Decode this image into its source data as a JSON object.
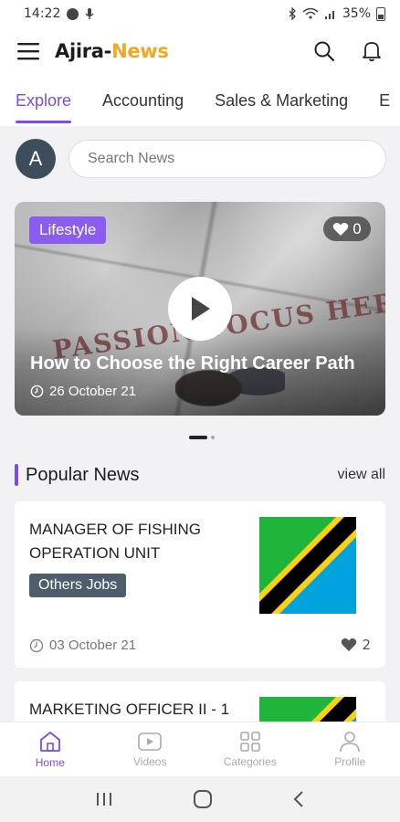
{
  "status_bar": {
    "time": "14:22",
    "battery": "35%"
  },
  "app": {
    "brand_part1": "Ajira-",
    "brand_part2": "News",
    "brand_color": "#f5a623",
    "accent_color": "#7a4de0"
  },
  "tabs": [
    {
      "label": "Explore",
      "active": true
    },
    {
      "label": "Accounting",
      "active": false
    },
    {
      "label": "Sales & Marketing",
      "active": false
    },
    {
      "label": "E",
      "active": false
    }
  ],
  "search": {
    "avatar_letter": "A",
    "placeholder": "Search News"
  },
  "featured": {
    "category": "Lifestyle",
    "likes": "0",
    "image_text": "PASSION FOCUS HERE",
    "title": "How to Choose the Right Career Path",
    "date": "26 October 21",
    "slide_index": 1,
    "slide_count": 2
  },
  "popular": {
    "heading": "Popular News",
    "view_all": "view all",
    "items": [
      {
        "title": "MANAGER OF FISHING OPERATION UNIT",
        "tag": "Others Jobs",
        "date": "03 October 21",
        "likes": "2",
        "thumb_icon": "tanzania-flag-icon"
      },
      {
        "title": "MARKETING OFFICER II - 1",
        "thumb_icon": "tanzania-flag-icon"
      }
    ]
  },
  "bottom_nav": [
    {
      "label": "Home",
      "icon": "home-icon",
      "active": true
    },
    {
      "label": "Videos",
      "icon": "video-icon",
      "active": false
    },
    {
      "label": "Categories",
      "icon": "grid-icon",
      "active": false
    },
    {
      "label": "Profile",
      "icon": "person-icon",
      "active": false
    }
  ]
}
